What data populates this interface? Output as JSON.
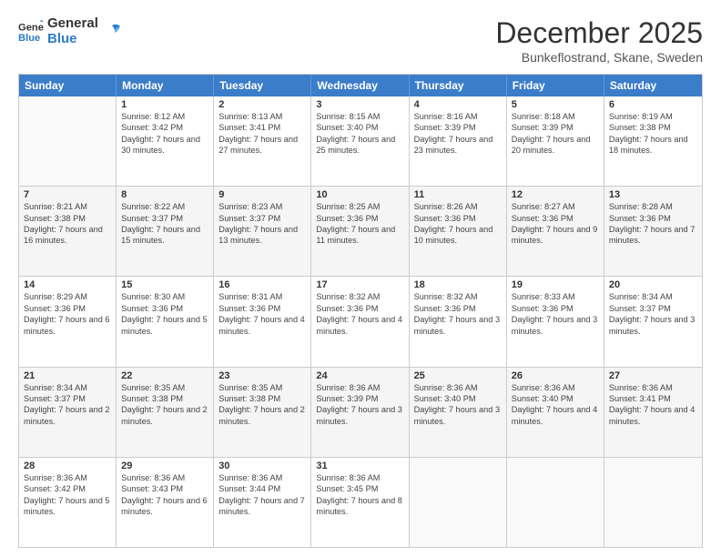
{
  "header": {
    "logo": {
      "line1": "General",
      "line2": "Blue"
    },
    "title": "December 2025",
    "location": "Bunkeflostrand, Skane, Sweden"
  },
  "days": [
    "Sunday",
    "Monday",
    "Tuesday",
    "Wednesday",
    "Thursday",
    "Friday",
    "Saturday"
  ],
  "weeks": [
    [
      {
        "day": "",
        "empty": true
      },
      {
        "day": "1",
        "sunrise": "Sunrise: 8:12 AM",
        "sunset": "Sunset: 3:42 PM",
        "daylight": "Daylight: 7 hours and 30 minutes."
      },
      {
        "day": "2",
        "sunrise": "Sunrise: 8:13 AM",
        "sunset": "Sunset: 3:41 PM",
        "daylight": "Daylight: 7 hours and 27 minutes."
      },
      {
        "day": "3",
        "sunrise": "Sunrise: 8:15 AM",
        "sunset": "Sunset: 3:40 PM",
        "daylight": "Daylight: 7 hours and 25 minutes."
      },
      {
        "day": "4",
        "sunrise": "Sunrise: 8:16 AM",
        "sunset": "Sunset: 3:39 PM",
        "daylight": "Daylight: 7 hours and 23 minutes."
      },
      {
        "day": "5",
        "sunrise": "Sunrise: 8:18 AM",
        "sunset": "Sunset: 3:39 PM",
        "daylight": "Daylight: 7 hours and 20 minutes."
      },
      {
        "day": "6",
        "sunrise": "Sunrise: 8:19 AM",
        "sunset": "Sunset: 3:38 PM",
        "daylight": "Daylight: 7 hours and 18 minutes."
      }
    ],
    [
      {
        "day": "7",
        "sunrise": "Sunrise: 8:21 AM",
        "sunset": "Sunset: 3:38 PM",
        "daylight": "Daylight: 7 hours and 16 minutes."
      },
      {
        "day": "8",
        "sunrise": "Sunrise: 8:22 AM",
        "sunset": "Sunset: 3:37 PM",
        "daylight": "Daylight: 7 hours and 15 minutes."
      },
      {
        "day": "9",
        "sunrise": "Sunrise: 8:23 AM",
        "sunset": "Sunset: 3:37 PM",
        "daylight": "Daylight: 7 hours and 13 minutes."
      },
      {
        "day": "10",
        "sunrise": "Sunrise: 8:25 AM",
        "sunset": "Sunset: 3:36 PM",
        "daylight": "Daylight: 7 hours and 11 minutes."
      },
      {
        "day": "11",
        "sunrise": "Sunrise: 8:26 AM",
        "sunset": "Sunset: 3:36 PM",
        "daylight": "Daylight: 7 hours and 10 minutes."
      },
      {
        "day": "12",
        "sunrise": "Sunrise: 8:27 AM",
        "sunset": "Sunset: 3:36 PM",
        "daylight": "Daylight: 7 hours and 9 minutes."
      },
      {
        "day": "13",
        "sunrise": "Sunrise: 8:28 AM",
        "sunset": "Sunset: 3:36 PM",
        "daylight": "Daylight: 7 hours and 7 minutes."
      }
    ],
    [
      {
        "day": "14",
        "sunrise": "Sunrise: 8:29 AM",
        "sunset": "Sunset: 3:36 PM",
        "daylight": "Daylight: 7 hours and 6 minutes."
      },
      {
        "day": "15",
        "sunrise": "Sunrise: 8:30 AM",
        "sunset": "Sunset: 3:36 PM",
        "daylight": "Daylight: 7 hours and 5 minutes."
      },
      {
        "day": "16",
        "sunrise": "Sunrise: 8:31 AM",
        "sunset": "Sunset: 3:36 PM",
        "daylight": "Daylight: 7 hours and 4 minutes."
      },
      {
        "day": "17",
        "sunrise": "Sunrise: 8:32 AM",
        "sunset": "Sunset: 3:36 PM",
        "daylight": "Daylight: 7 hours and 4 minutes."
      },
      {
        "day": "18",
        "sunrise": "Sunrise: 8:32 AM",
        "sunset": "Sunset: 3:36 PM",
        "daylight": "Daylight: 7 hours and 3 minutes."
      },
      {
        "day": "19",
        "sunrise": "Sunrise: 8:33 AM",
        "sunset": "Sunset: 3:36 PM",
        "daylight": "Daylight: 7 hours and 3 minutes."
      },
      {
        "day": "20",
        "sunrise": "Sunrise: 8:34 AM",
        "sunset": "Sunset: 3:37 PM",
        "daylight": "Daylight: 7 hours and 3 minutes."
      }
    ],
    [
      {
        "day": "21",
        "sunrise": "Sunrise: 8:34 AM",
        "sunset": "Sunset: 3:37 PM",
        "daylight": "Daylight: 7 hours and 2 minutes."
      },
      {
        "day": "22",
        "sunrise": "Sunrise: 8:35 AM",
        "sunset": "Sunset: 3:38 PM",
        "daylight": "Daylight: 7 hours and 2 minutes."
      },
      {
        "day": "23",
        "sunrise": "Sunrise: 8:35 AM",
        "sunset": "Sunset: 3:38 PM",
        "daylight": "Daylight: 7 hours and 2 minutes."
      },
      {
        "day": "24",
        "sunrise": "Sunrise: 8:36 AM",
        "sunset": "Sunset: 3:39 PM",
        "daylight": "Daylight: 7 hours and 3 minutes."
      },
      {
        "day": "25",
        "sunrise": "Sunrise: 8:36 AM",
        "sunset": "Sunset: 3:40 PM",
        "daylight": "Daylight: 7 hours and 3 minutes."
      },
      {
        "day": "26",
        "sunrise": "Sunrise: 8:36 AM",
        "sunset": "Sunset: 3:40 PM",
        "daylight": "Daylight: 7 hours and 4 minutes."
      },
      {
        "day": "27",
        "sunrise": "Sunrise: 8:36 AM",
        "sunset": "Sunset: 3:41 PM",
        "daylight": "Daylight: 7 hours and 4 minutes."
      }
    ],
    [
      {
        "day": "28",
        "sunrise": "Sunrise: 8:36 AM",
        "sunset": "Sunset: 3:42 PM",
        "daylight": "Daylight: 7 hours and 5 minutes."
      },
      {
        "day": "29",
        "sunrise": "Sunrise: 8:36 AM",
        "sunset": "Sunset: 3:43 PM",
        "daylight": "Daylight: 7 hours and 6 minutes."
      },
      {
        "day": "30",
        "sunrise": "Sunrise: 8:36 AM",
        "sunset": "Sunset: 3:44 PM",
        "daylight": "Daylight: 7 hours and 7 minutes."
      },
      {
        "day": "31",
        "sunrise": "Sunrise: 8:36 AM",
        "sunset": "Sunset: 3:45 PM",
        "daylight": "Daylight: 7 hours and 8 minutes."
      },
      {
        "day": "",
        "empty": true
      },
      {
        "day": "",
        "empty": true
      },
      {
        "day": "",
        "empty": true
      }
    ]
  ]
}
